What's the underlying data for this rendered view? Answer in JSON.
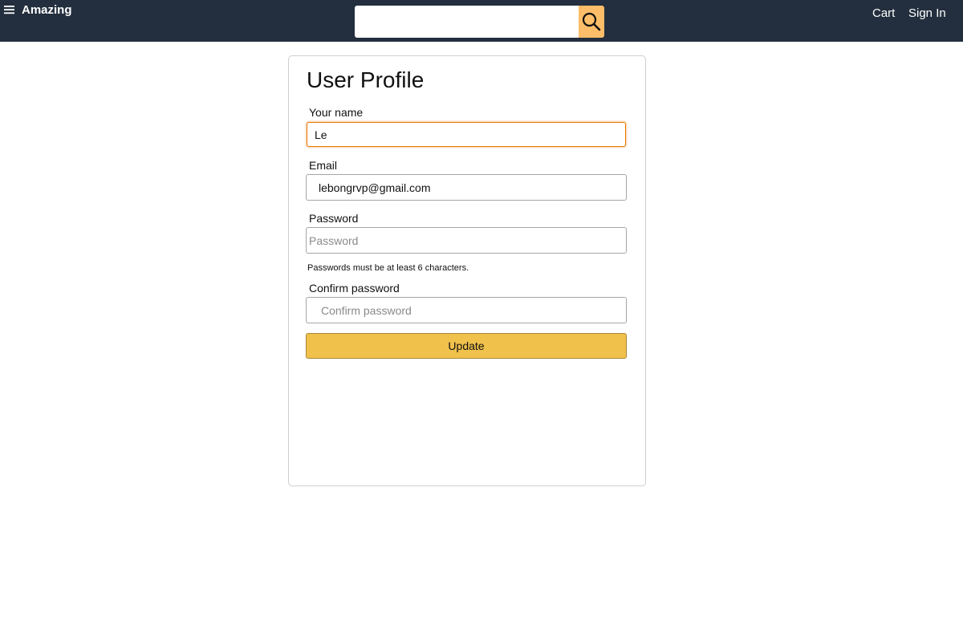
{
  "header": {
    "brand": "Amazing",
    "search": {
      "value": "",
      "placeholder": ""
    },
    "cart_label": "Cart",
    "signin_label": "Sign In"
  },
  "profile": {
    "title": "User Profile",
    "name": {
      "label": "Your name",
      "value": "Le",
      "placeholder": ""
    },
    "email": {
      "label": "Email",
      "value": "lebongrvp@gmail.com",
      "placeholder": ""
    },
    "password": {
      "label": "Password",
      "value": "",
      "placeholder": "Password"
    },
    "password_hint": "Passwords must be at least 6 characters.",
    "confirm": {
      "label": "Confirm password",
      "value": "",
      "placeholder": "Confirm password"
    },
    "update_label": "Update"
  },
  "colors": {
    "header_bg": "#232f3e",
    "search_button": "#febd69",
    "update_button": "#f0c14b",
    "focus_border": "#e77600"
  },
  "icons": {
    "menu": "hamburger-icon",
    "search": "magnifier-icon"
  }
}
